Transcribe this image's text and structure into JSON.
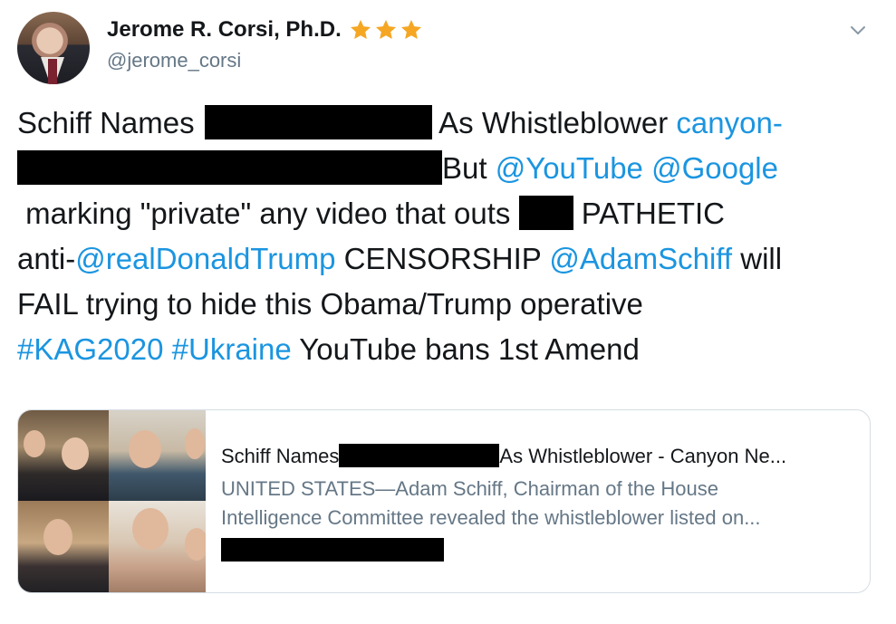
{
  "tweet": {
    "author_name": "Jerome R. Corsi, Ph.D.",
    "author_handle": "@jerome_corsi",
    "lines": {
      "l1_a": "Schiff Names",
      "l1_b": "As Whistleblower",
      "l1_link": "canyon-",
      "l2_a": "But",
      "l2_link1": "@YouTube",
      "l2_link2": "@Google",
      "l3_a": "marking \"private\" any video that outs",
      "l3_b": "PATHETIC",
      "l4_a": "anti-",
      "l4_link1": "@realDonaldTrump",
      "l4_b": "CENSORSHIP",
      "l4_link2": "@AdamSchiff",
      "l4_c": "will",
      "l5": "FAIL trying to hide this Obama/Trump operative",
      "l6_link1": "#KAG2020",
      "l6_link2": "#Ukraine",
      "l6_b": "YouTube bans 1st Amend"
    }
  },
  "card": {
    "title_a": "Schiff Names",
    "title_b": "As Whistleblower - Canyon Ne...",
    "desc_line1": "UNITED STATES—Adam Schiff, Chairman of the House",
    "desc_line2": "Intelligence Committee revealed the whistleblower listed on..."
  },
  "colors": {
    "link": "#1b95e0",
    "star": "#f5a623",
    "secondary_text": "#657786",
    "redaction": "#000000"
  },
  "icons": {
    "stars": [
      "star-icon",
      "star-icon",
      "star-icon"
    ],
    "menu": "chevron-down-icon"
  }
}
